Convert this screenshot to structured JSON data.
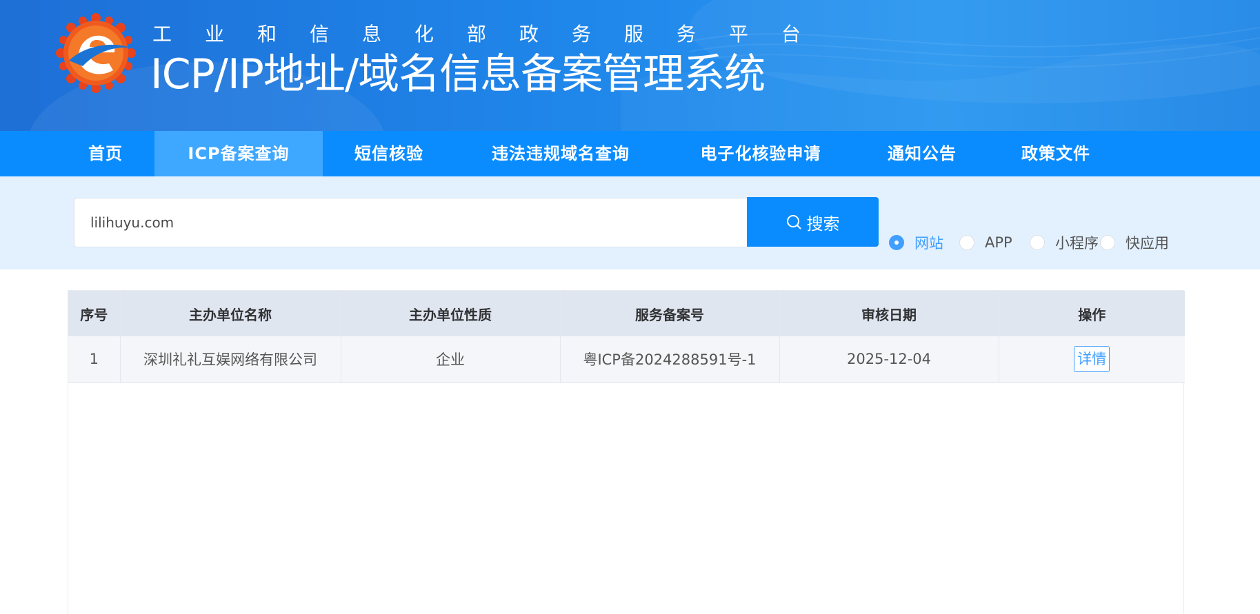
{
  "header": {
    "subtitle": "工业和信息化部政务服务平台",
    "title": "ICP/IP地址/域名信息备案管理系统"
  },
  "nav": {
    "items": [
      {
        "label": "首页"
      },
      {
        "label": "ICP备案查询",
        "active": true
      },
      {
        "label": "短信核验"
      },
      {
        "label": "违法违规域名查询"
      },
      {
        "label": "电子化核验申请"
      },
      {
        "label": "通知公告"
      },
      {
        "label": "政策文件"
      }
    ]
  },
  "search": {
    "value": "lilihuyu.com",
    "button_label": "搜索",
    "icon": "search-icon",
    "options": [
      {
        "label": "网站",
        "checked": true
      },
      {
        "label": "APP",
        "checked": false
      },
      {
        "label": "小程序",
        "checked": false
      },
      {
        "label": "快应用",
        "checked": false
      }
    ]
  },
  "table": {
    "headers": [
      "序号",
      "主办单位名称",
      "主办单位性质",
      "服务备案号",
      "审核日期",
      "操作"
    ],
    "rows": [
      {
        "index": "1",
        "org_name": "深圳礼礼互娱网络有限公司",
        "org_type": "企业",
        "record_no": "粤ICP备2024288591号-1",
        "date": "2025-12-04",
        "action_label": "详情"
      }
    ]
  },
  "colors": {
    "nav_bg": "#0a8cff",
    "nav_active_bg": "#3ea7ff",
    "search_strip_bg": "#e3f1ff",
    "accent": "#409eff"
  }
}
